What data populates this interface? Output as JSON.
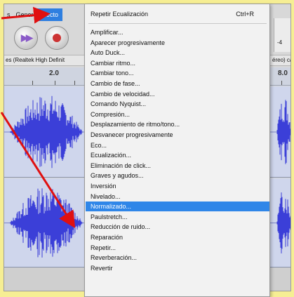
{
  "menubar": {
    "items": [
      "s",
      "Gener",
      "Efecto"
    ],
    "active_index": 2
  },
  "toolbar": {
    "skip_icon": "skip-forward-icon",
    "record_icon": "record-icon"
  },
  "right_toolbar": {
    "level_text": "-4"
  },
  "device_bar": {
    "output_device": "es (Realtek High Definit",
    "channels": "éreo) ca"
  },
  "ruler": {
    "labels": [
      "2.0",
      "8.0"
    ]
  },
  "menu": {
    "top_item": {
      "label": "Repetir Ecualización",
      "shortcut": "Ctrl+R"
    },
    "items": [
      "Amplificar...",
      "Aparecer progresivamente",
      "Auto Duck...",
      "Cambiar ritmo...",
      "Cambiar tono...",
      "Cambio de fase...",
      "Cambio de velocidad...",
      "Comando Nyquist...",
      "Compresión...",
      "Desplazamiento de ritmo/tono...",
      "Desvanecer progresivamente",
      "Eco...",
      "Ecualización...",
      "Eliminación de click...",
      "Graves y agudos...",
      "Inversión",
      "Nivelado...",
      "Normalizado...",
      "Paulstretch...",
      "Reducción de ruido...",
      "Reparación",
      "Repetir...",
      "Reverberación...",
      "Revertir"
    ],
    "highlighted_index": 17
  },
  "colors": {
    "background": "#f6ee93",
    "highlight": "#2f86e8",
    "waveform": "#3b3fd8",
    "arrow": "#e01010"
  }
}
